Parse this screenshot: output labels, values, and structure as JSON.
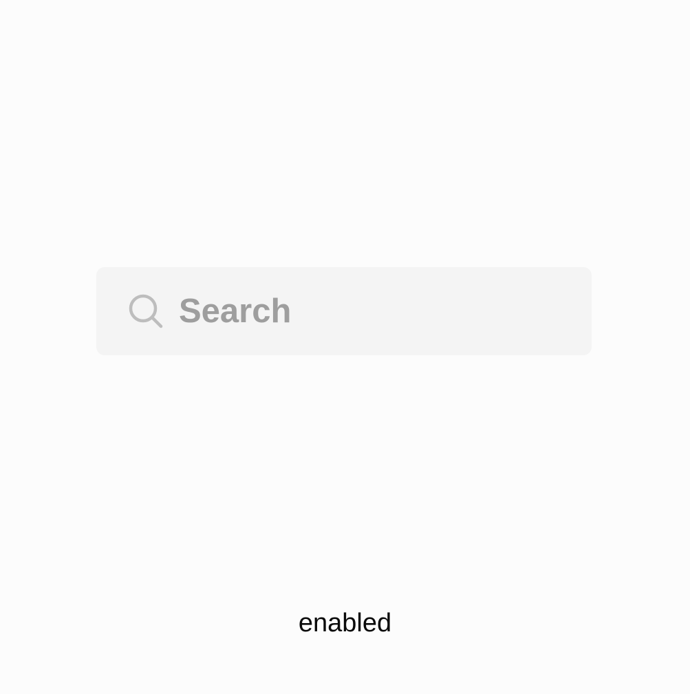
{
  "search": {
    "placeholder": "Search",
    "value": "",
    "icon": "search-icon",
    "background_color": "#f4f4f4",
    "placeholder_color": "#9e9e9e",
    "icon_color": "#bdbdbd"
  },
  "state": {
    "label": "enabled"
  }
}
